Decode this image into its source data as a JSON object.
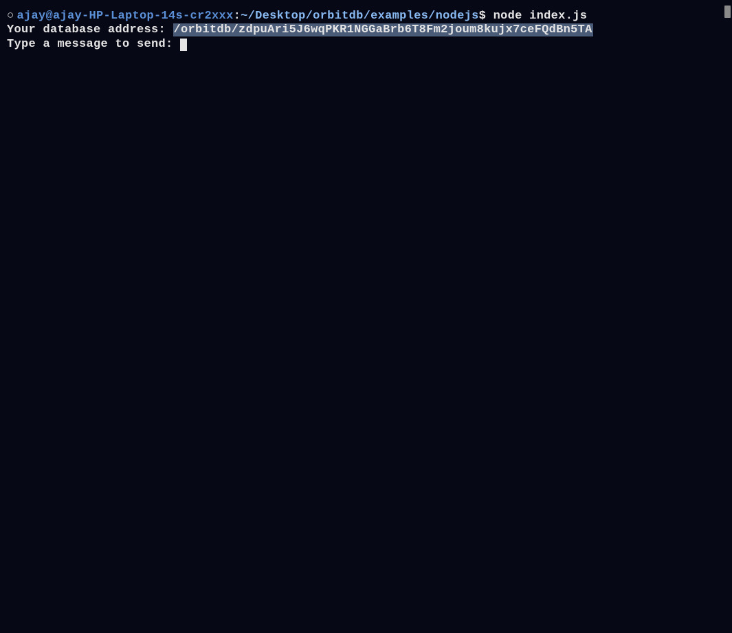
{
  "prompt": {
    "bullet": "○",
    "user_host": "ajay@ajay-HP-Laptop-14s-cr2xxx",
    "colon": ":",
    "path": "~/Desktop/orbitdb/examples/nodejs",
    "dollar": "$ ",
    "command": "node index.js"
  },
  "output": {
    "address_label": "Your database address: ",
    "address_value": "/orbitdb/zdpuAri5J6wqPKR1NGGaBrb6T8Fm2joum8kujx7ceFQdBn5TA",
    "input_prompt": "Type a message to send: "
  }
}
